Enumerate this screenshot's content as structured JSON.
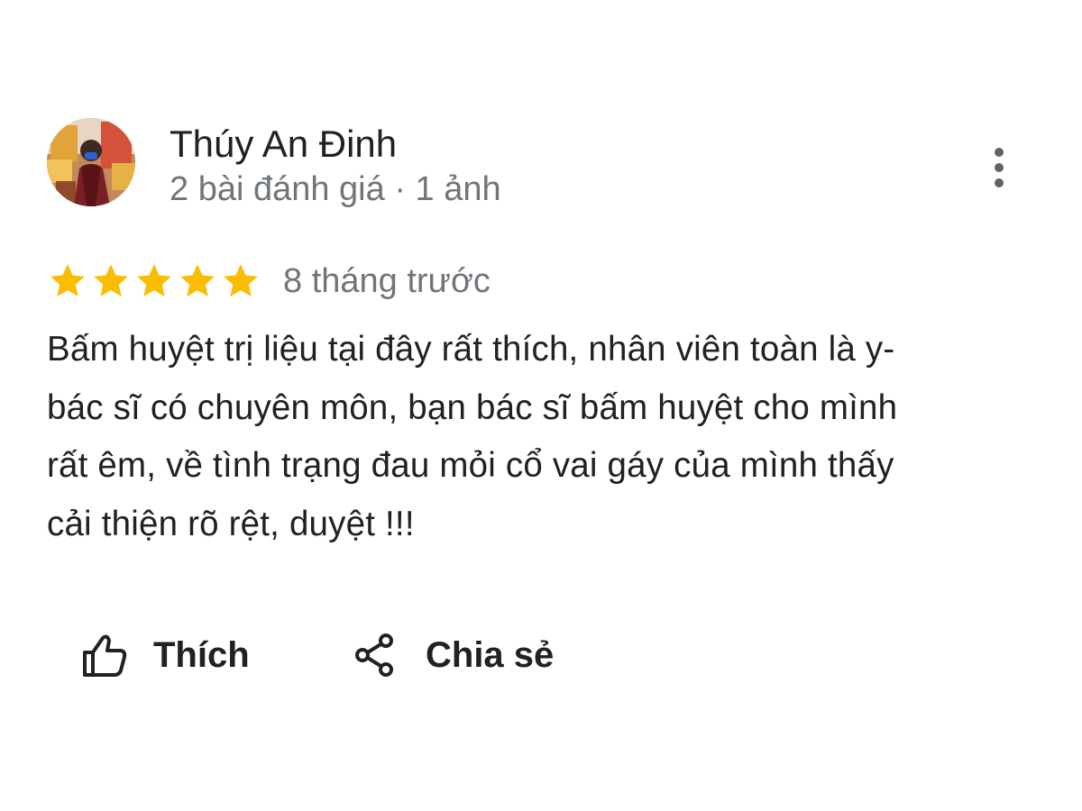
{
  "review": {
    "author": {
      "name": "Thúy An Đinh",
      "meta": "2 bài đánh giá · 1 ảnh"
    },
    "rating": {
      "stars": 5,
      "max": 5,
      "star_color": "#fbbc04"
    },
    "time": "8 tháng trước",
    "text_lines": [
      "Bấm huyệt trị liệu tại đây rất thích, nhân viên toàn là y-",
      "bác sĩ có chuyên môn, bạn bác sĩ bấm huyệt cho mình",
      "rất êm, về tình trạng đau mỏi cổ vai gáy của mình thấy",
      "cải thiện rõ rệt, duyệt !!!"
    ],
    "actions": {
      "like_label": "Thích",
      "share_label": "Chia sẻ"
    },
    "icons": {
      "more": "more-vert-icon",
      "like": "thumb-up-icon",
      "share": "share-icon"
    }
  }
}
